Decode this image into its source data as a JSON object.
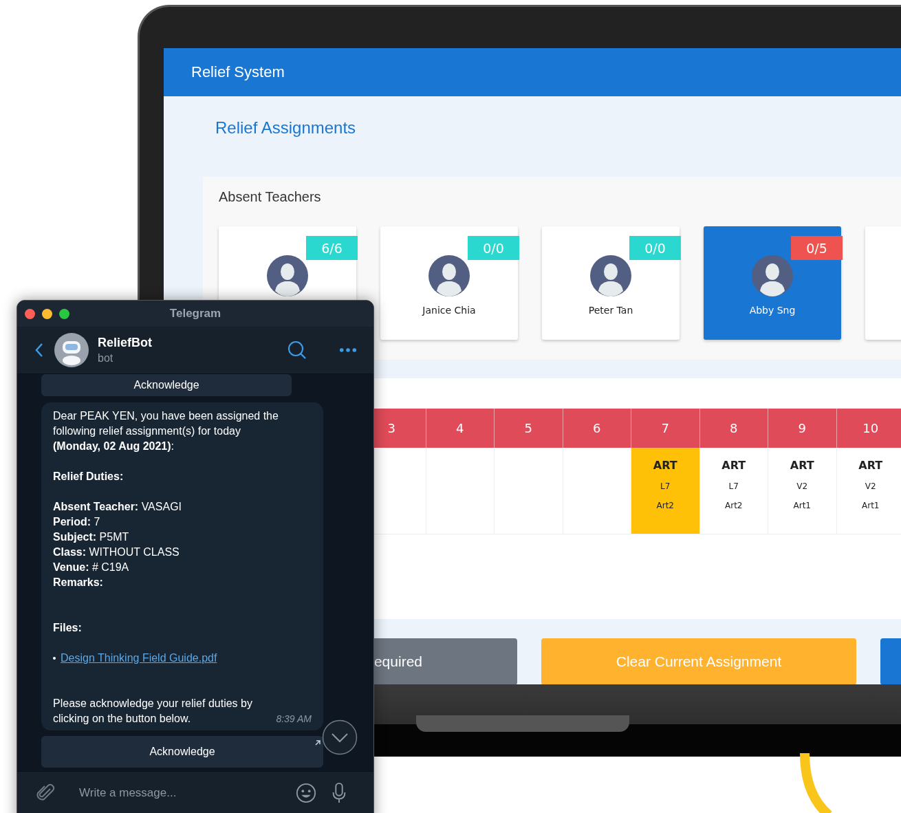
{
  "app": {
    "title": "Relief System",
    "page_title": "Relief Assignments"
  },
  "absent_teachers": {
    "title": "Absent Teachers",
    "cards": [
      {
        "badge": "6/6",
        "color": "#2ad8d0",
        "selected": false
      },
      {
        "badge": "0/0",
        "color": "#2ad8d0",
        "name": "Janice Chia",
        "selected": false
      },
      {
        "badge": "0/0",
        "color": "#2ad8d0",
        "name": "Peter Tan",
        "selected": false
      },
      {
        "badge": "0/5",
        "color": "#ef5350",
        "name": "Abby Sng",
        "selected": true
      }
    ]
  },
  "timetable": {
    "columns": [
      "3",
      "4",
      "5",
      "6",
      "7",
      "8",
      "9",
      "10"
    ],
    "cells": [
      {
        "selected": false
      },
      {
        "selected": false
      },
      {
        "selected": false
      },
      {
        "selected": false
      },
      {
        "subject": "ART",
        "room": "L7",
        "class": "Art2",
        "selected": true
      },
      {
        "subject": "ART",
        "room": "L7",
        "class": "Art2",
        "selected": false
      },
      {
        "subject": "ART",
        "room": "V2",
        "class": "Art1",
        "selected": false
      },
      {
        "subject": "ART",
        "room": "V2",
        "class": "Art1",
        "selected": false
      }
    ]
  },
  "actions": [
    {
      "label": "equired",
      "kind": "secondary"
    },
    {
      "label": "Clear Current Assignment",
      "kind": "warning"
    }
  ],
  "telegram": {
    "window_title": "Telegram",
    "chat_name": "ReliefBot",
    "chat_status": "bot",
    "top_button": "Acknowledge",
    "message": {
      "intro": "Dear PEAK YEN, you have been assigned the following relief assignment(s) for today **(Monday, 02 Aug 2021)**:",
      "heading": "Relief Duties:",
      "details": [
        {
          "label": "Absent Teacher:",
          "value": "VASAGI"
        },
        {
          "label": "Period:",
          "value": "7"
        },
        {
          "label": "Subject:",
          "value": "P5MT"
        },
        {
          "label": "Class:",
          "value": "WITHOUT CLASS"
        },
        {
          "label": "Venue:",
          "value": "# C19A"
        },
        {
          "label": "Remarks:"
        }
      ],
      "files_heading": "Files:",
      "files": [
        "Design Thinking Field Guide.pdf"
      ],
      "closing": "Please acknowledge your relief duties by clicking on the button below.",
      "time": "8:39 AM"
    },
    "bottom_button": "Acknowledge",
    "input_placeholder": "Write a message..."
  }
}
